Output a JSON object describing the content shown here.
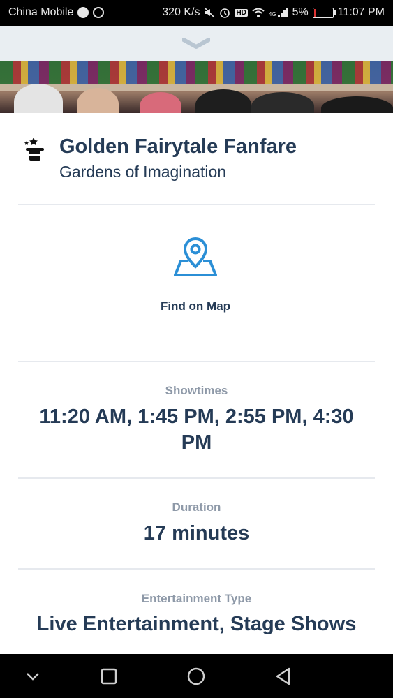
{
  "status_bar": {
    "carrier": "China Mobile",
    "net_speed": "320 K/s",
    "network_badge": "HD",
    "network_type": "4G",
    "battery": "5%",
    "time": "11:07 PM",
    "icons": [
      "globe-icon",
      "whatsapp-icon",
      "mute-icon",
      "alarm-icon",
      "hd-icon",
      "wifi-icon",
      "signal-icon",
      "battery-icon"
    ],
    "battery_level": 0.05,
    "battery_color": "#dd3333"
  },
  "detail": {
    "title": "Golden Fairytale Fanfare",
    "location": "Gardens of Imagination",
    "title_icon": "magic-hat-icon",
    "map_action": "Find on Map",
    "map_icon": "map-pin-icon",
    "showtimes_label": "Showtimes",
    "showtimes_value": "11:20 AM, 1:45 PM, 2:55 PM, 4:30 PM",
    "duration_label": "Duration",
    "duration_value": "17 minutes",
    "entertainment_label": "Entertainment Type",
    "entertainment_value": "Live Entertainment, Stage Shows"
  },
  "colors": {
    "primary_text": "#253b56",
    "secondary_text": "#8e99a8",
    "accent_blue": "#2b8fd6",
    "pull_bar": "#e9eef2"
  },
  "nav": {
    "buttons": [
      "chevron-down-icon",
      "recents-icon",
      "home-icon",
      "back-icon"
    ]
  }
}
